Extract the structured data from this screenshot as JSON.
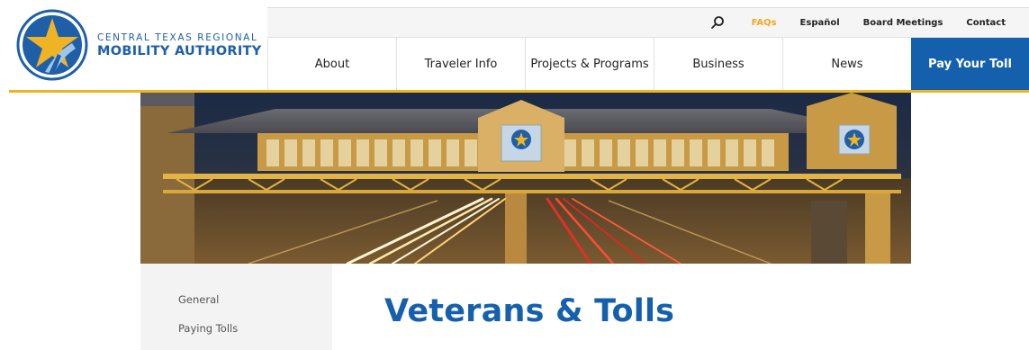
{
  "logo": {
    "line1": "CENTRAL TEXAS REGIONAL",
    "line2": "MOBILITY AUTHORITY"
  },
  "utility_nav": {
    "search_icon": "search-icon",
    "items": [
      "FAQs",
      "Español",
      "Board Meetings",
      "Contact"
    ]
  },
  "main_nav": {
    "items": [
      "About",
      "Traveler Info",
      "Projects & Programs",
      "Business",
      "News",
      "Pay Your Toll"
    ]
  },
  "sidebar": {
    "items": [
      "General",
      "Paying Tolls"
    ]
  },
  "page": {
    "title": "Veterans & Tolls"
  },
  "colors": {
    "brand_blue": "#1560ad",
    "accent_gold": "#f0b323"
  }
}
